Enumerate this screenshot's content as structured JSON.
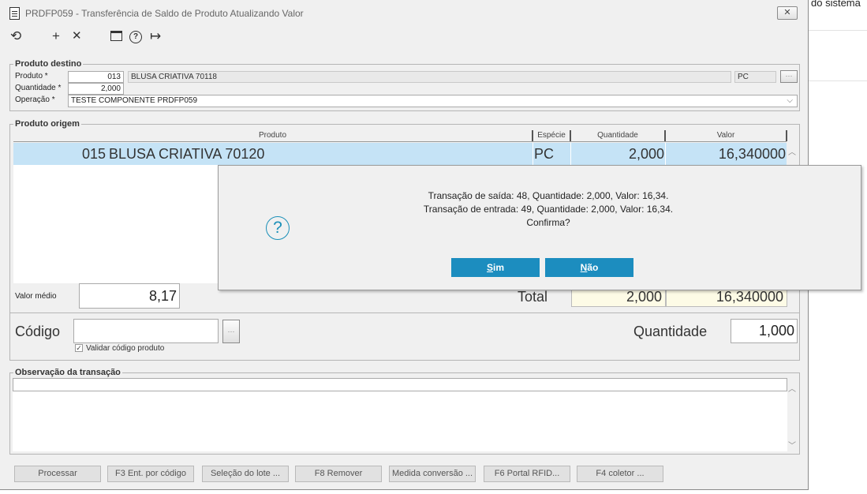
{
  "background": {
    "right_text": "do sistema"
  },
  "window": {
    "title": "PRDFP059 - Transferência de Saldo de Produto Atualizando Valor",
    "close_label": "✕"
  },
  "toolbar": {
    "undo_icon": "undo-icon",
    "add_icon": "plus-icon",
    "delete_icon": "close-icon",
    "calendar_icon": "calendar-icon",
    "help_icon": "help-icon",
    "exit_icon": "exit-icon",
    "glyphs": {
      "undo": "⟲",
      "add": "+",
      "delete": "✕",
      "help": "?",
      "exit": "↦"
    }
  },
  "destino": {
    "legend": "Produto destino",
    "produto_label": "Produto *",
    "produto_code": "013",
    "produto_desc": "BLUSA CRIATIVA 70118",
    "produto_unit": "PC",
    "quantidade_label": "Quantidade *",
    "quantidade_value": "2,000",
    "operacao_label": "Operação *",
    "operacao_value": "TESTE COMPONENTE PRDFP059"
  },
  "origem": {
    "legend": "Produto origem",
    "columns": [
      "Produto",
      "Espécie",
      "Quantidade",
      "Valor"
    ],
    "rows": [
      {
        "code": "015",
        "produto": "BLUSA CRIATIVA 70120",
        "especie": "PC",
        "quantidade": "2,000",
        "valor": "16,340000"
      }
    ],
    "valor_medio_label": "Valor médio",
    "valor_medio_value": "8,17",
    "total_label": "Total",
    "total_quantidade": "2,000",
    "total_valor": "16,340000"
  },
  "codigo": {
    "label": "Código",
    "value": "",
    "validar_label": "Validar código produto",
    "validar_checked": true,
    "quantidade_label": "Quantidade",
    "quantidade_value": "1,000"
  },
  "observacao": {
    "legend": "Observação da transação",
    "value": ""
  },
  "dialog": {
    "line1": "Transação de saída: 48, Quantidade: 2,000, Valor: 16,34.",
    "line2": "Transação de entrada: 49, Quantidade: 2,000, Valor: 16,34.",
    "line3": "Confirma?",
    "yes_hotkey": "S",
    "yes_rest": "im",
    "no_hotkey": "N",
    "no_rest": "ão",
    "icon": "question-icon"
  },
  "buttons": [
    "Processar",
    "F3 Ent. por código",
    "Seleção do lote ...",
    "F8 Remover",
    "Medida conversão ...",
    "F6 Portal RFID...",
    "F4 coletor ..."
  ],
  "colors": {
    "accent": "#1c8dbf",
    "selected_row": "#c5e3f6",
    "total_bg": "#fdfbe6"
  }
}
